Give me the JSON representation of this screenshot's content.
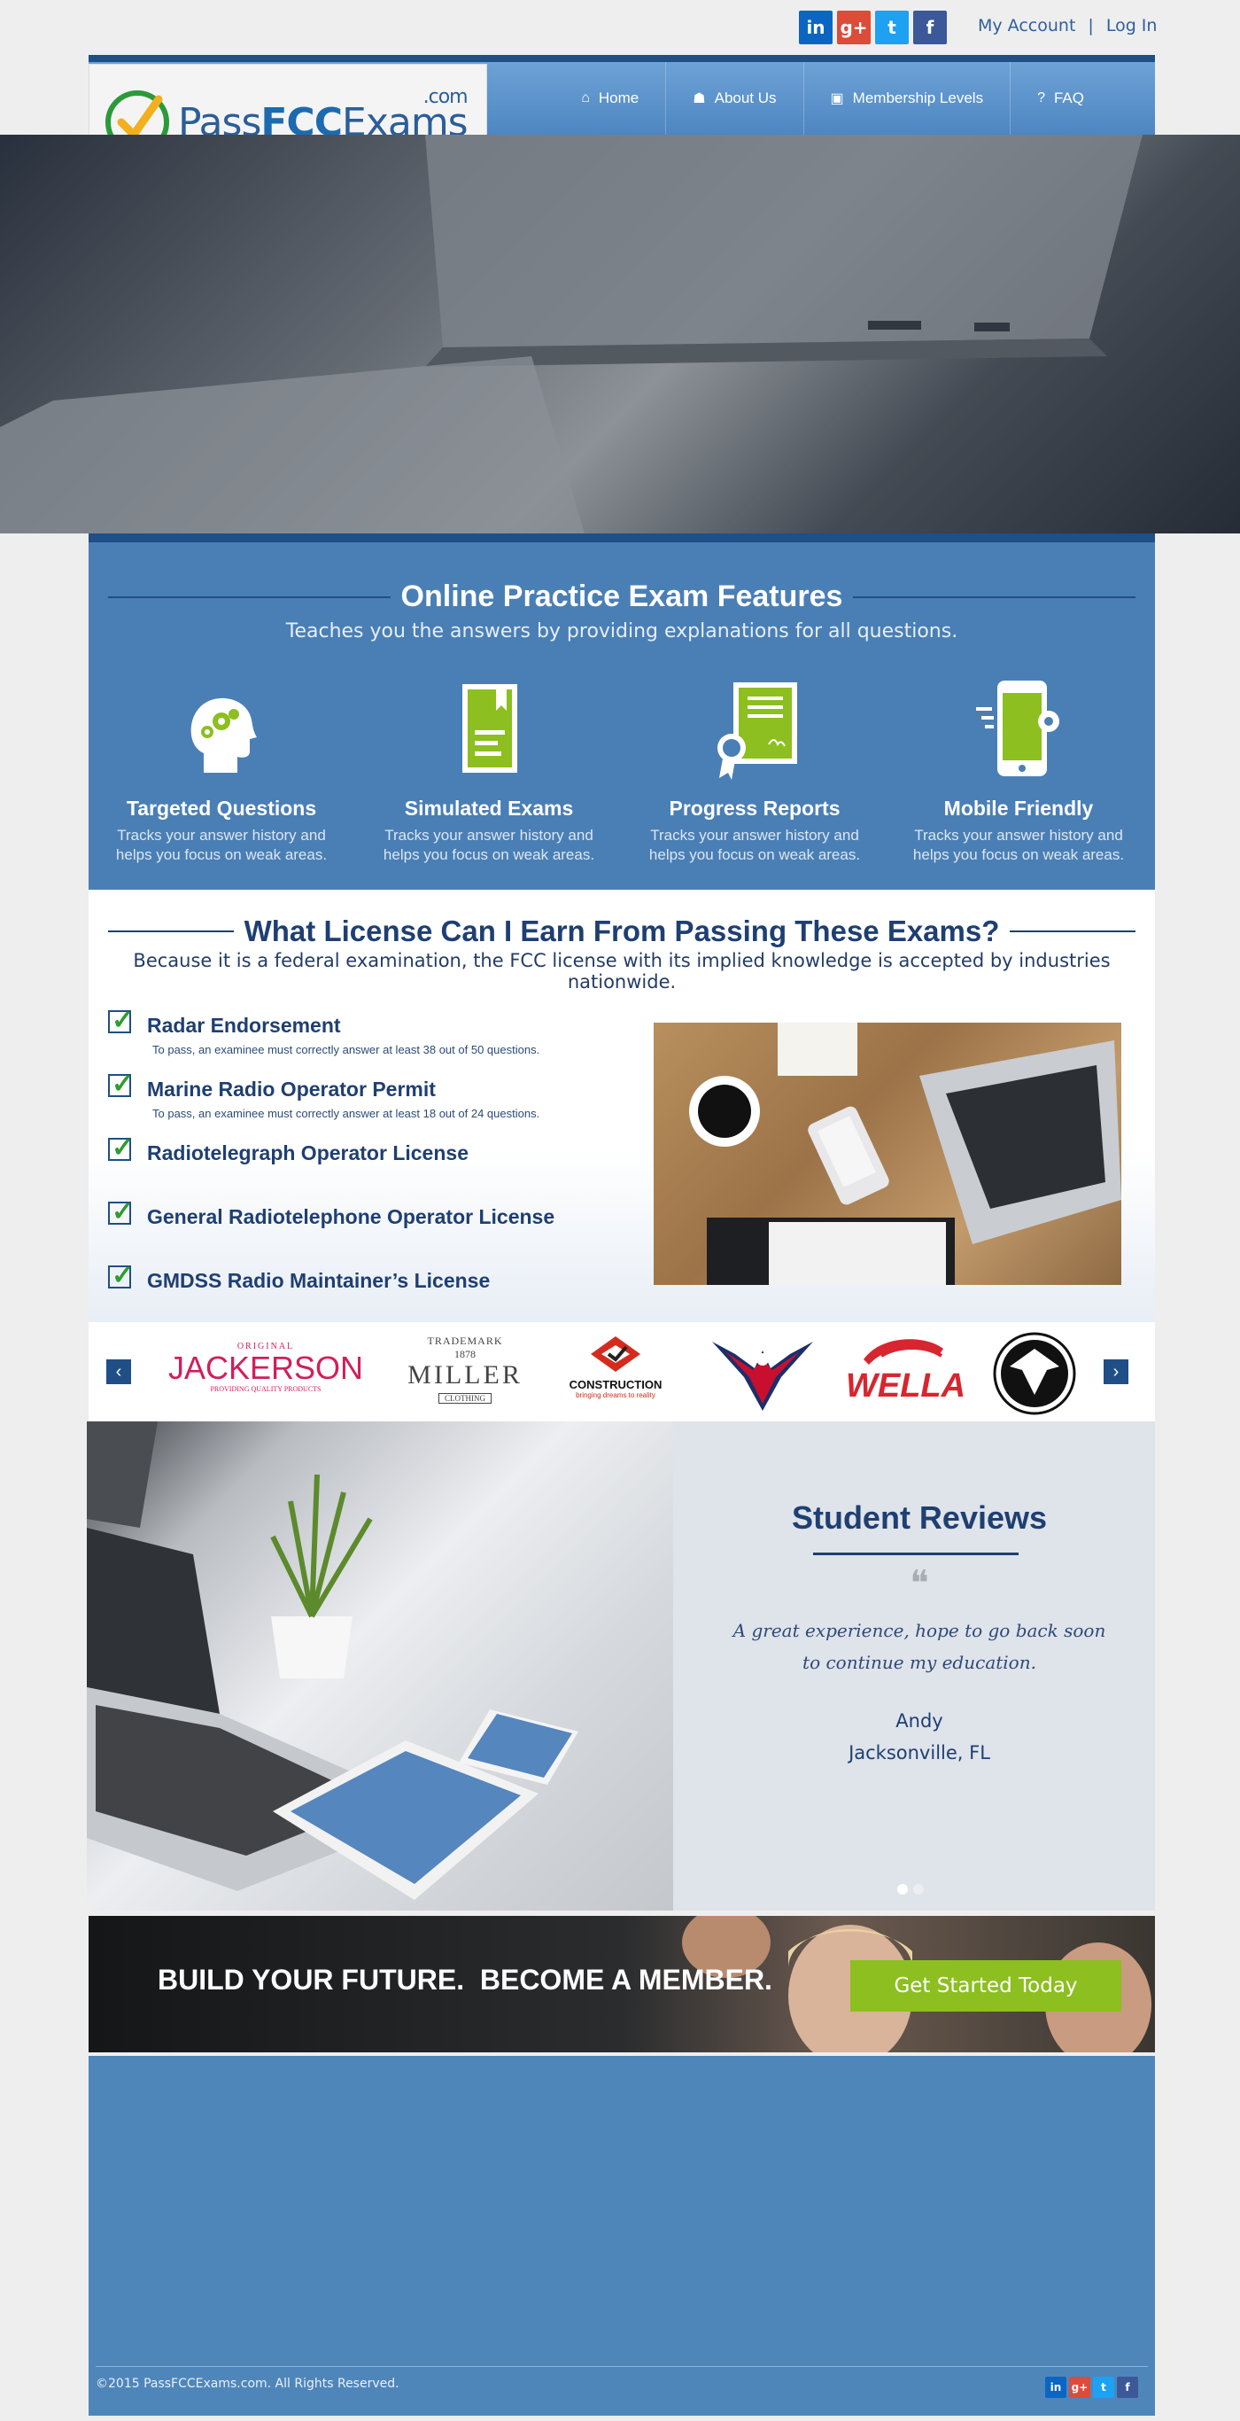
{
  "topbar": {
    "social": [
      {
        "icon": "linkedin-icon",
        "glyph": "in"
      },
      {
        "icon": "google-plus-icon",
        "glyph": "g+"
      },
      {
        "icon": "twitter-icon",
        "glyph": "t"
      },
      {
        "icon": "facebook-icon",
        "glyph": "f"
      }
    ],
    "my_account": "My Account",
    "separator": "|",
    "log_in": "Log In"
  },
  "brand": {
    "prefix": "Pass",
    "bold": "FCC",
    "suffix": "Exams",
    "tld": ".com"
  },
  "nav": [
    {
      "label": "Home",
      "icon": "home-icon"
    },
    {
      "label": "About Us",
      "icon": "users-icon"
    },
    {
      "label": "Membership Levels",
      "icon": "card-icon"
    },
    {
      "label": "FAQ",
      "icon": "question-icon"
    }
  ],
  "features": {
    "title": "Online Practice Exam Features",
    "subtitle": "Teaches you the answers by providing explanations for all questions.",
    "items": [
      {
        "title": "Targeted Questions",
        "desc1": "Tracks your answer history and",
        "desc2": "helps you focus on weak areas.",
        "icon": "head-gears-icon"
      },
      {
        "title": "Simulated Exams",
        "desc1": "Tracks your answer history and",
        "desc2": "helps you focus on weak areas.",
        "icon": "exam-document-icon"
      },
      {
        "title": "Progress Reports",
        "desc1": "Tracks your answer history and",
        "desc2": "helps you focus on weak areas.",
        "icon": "certificate-icon"
      },
      {
        "title": "Mobile Friendly",
        "desc1": "Tracks your answer history and",
        "desc2": "helps you focus on weak areas.",
        "icon": "mobile-gear-icon"
      }
    ]
  },
  "license": {
    "title": "What License Can I Earn From Passing These Exams?",
    "subtitle": "Because it is a federal examination, the FCC license with its implied knowledge is accepted by industries nationwide.",
    "items": [
      {
        "title": "Radar Endorsement",
        "note": "To pass, an examinee must correctly answer at least 38 out of 50 questions."
      },
      {
        "title": "Marine Radio Operator Permit",
        "note": "To pass, an examinee must correctly answer at least 18 out of 24 questions."
      },
      {
        "title": "Radiotelegraph Operator License",
        "note": ""
      },
      {
        "title": "General Radiotelephone Operator License",
        "note": ""
      },
      {
        "title": "GMDSS Radio Maintainer’s License",
        "note": ""
      }
    ]
  },
  "brands": {
    "prev": "‹",
    "next": "›",
    "jackerson": {
      "top": "ORIGINAL",
      "name": "JACKERSON",
      "tag": "PROVIDING QUALITY PRODUCTS"
    },
    "miller": {
      "top": "TRADEMARK",
      "year": "1878",
      "name": "MILLER",
      "tag": "CLOTHING"
    },
    "construction": {
      "name": "CONSTRUCTION",
      "tag": "bringing dreams to reality"
    },
    "wella": {
      "name": "WELLA"
    }
  },
  "reviews": {
    "title": "Student Reviews",
    "quote_mark": "❝",
    "quote_line1": "A great experience, hope to go back soon",
    "quote_line2": "to continue my education.",
    "name": "Andy",
    "location": "Jacksonville, FL"
  },
  "cta": {
    "text": "BUILD YOUR FUTURE.  BECOME A MEMBER.",
    "button": "Get Started Today"
  },
  "footer": {
    "copyright": "©2015 PassFCCExams.com. All Rights Reserved."
  },
  "colors": {
    "primary": "#4a7fb5",
    "dark_blue": "#1f4f86",
    "accent_green": "#8cbf1f"
  }
}
